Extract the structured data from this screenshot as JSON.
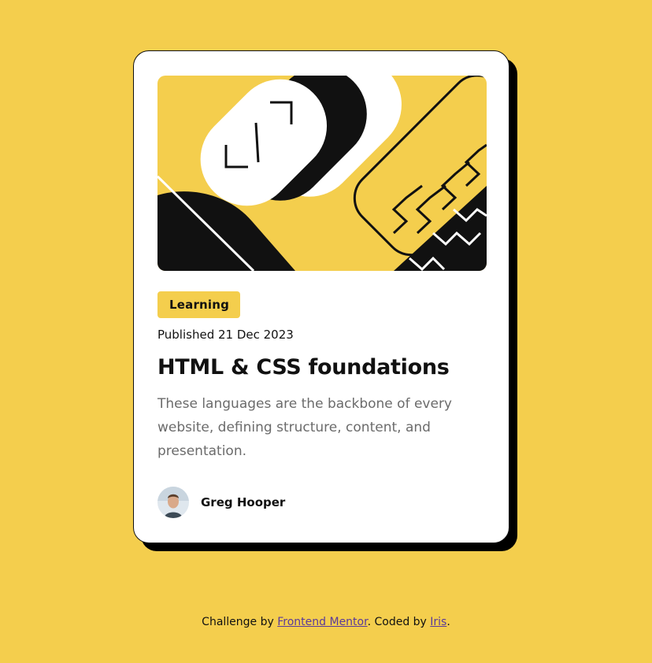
{
  "card": {
    "tag": "Learning",
    "published": "Published 21 Dec 2023",
    "title": "HTML & CSS foundations",
    "description": "These languages are the backbone of every website, defining structure, content, and presentation.",
    "author": {
      "name": "Greg Hooper"
    }
  },
  "attribution": {
    "prefix": "Challenge by ",
    "link1": "Frontend Mentor",
    "middle": ". Coded by ",
    "link2": "Iris",
    "suffix": "."
  },
  "colors": {
    "background": "#f4ce4d",
    "card": "#ffffff",
    "text": "#111111",
    "muted": "#6b6b6b",
    "accent": "#f4ce4d"
  }
}
